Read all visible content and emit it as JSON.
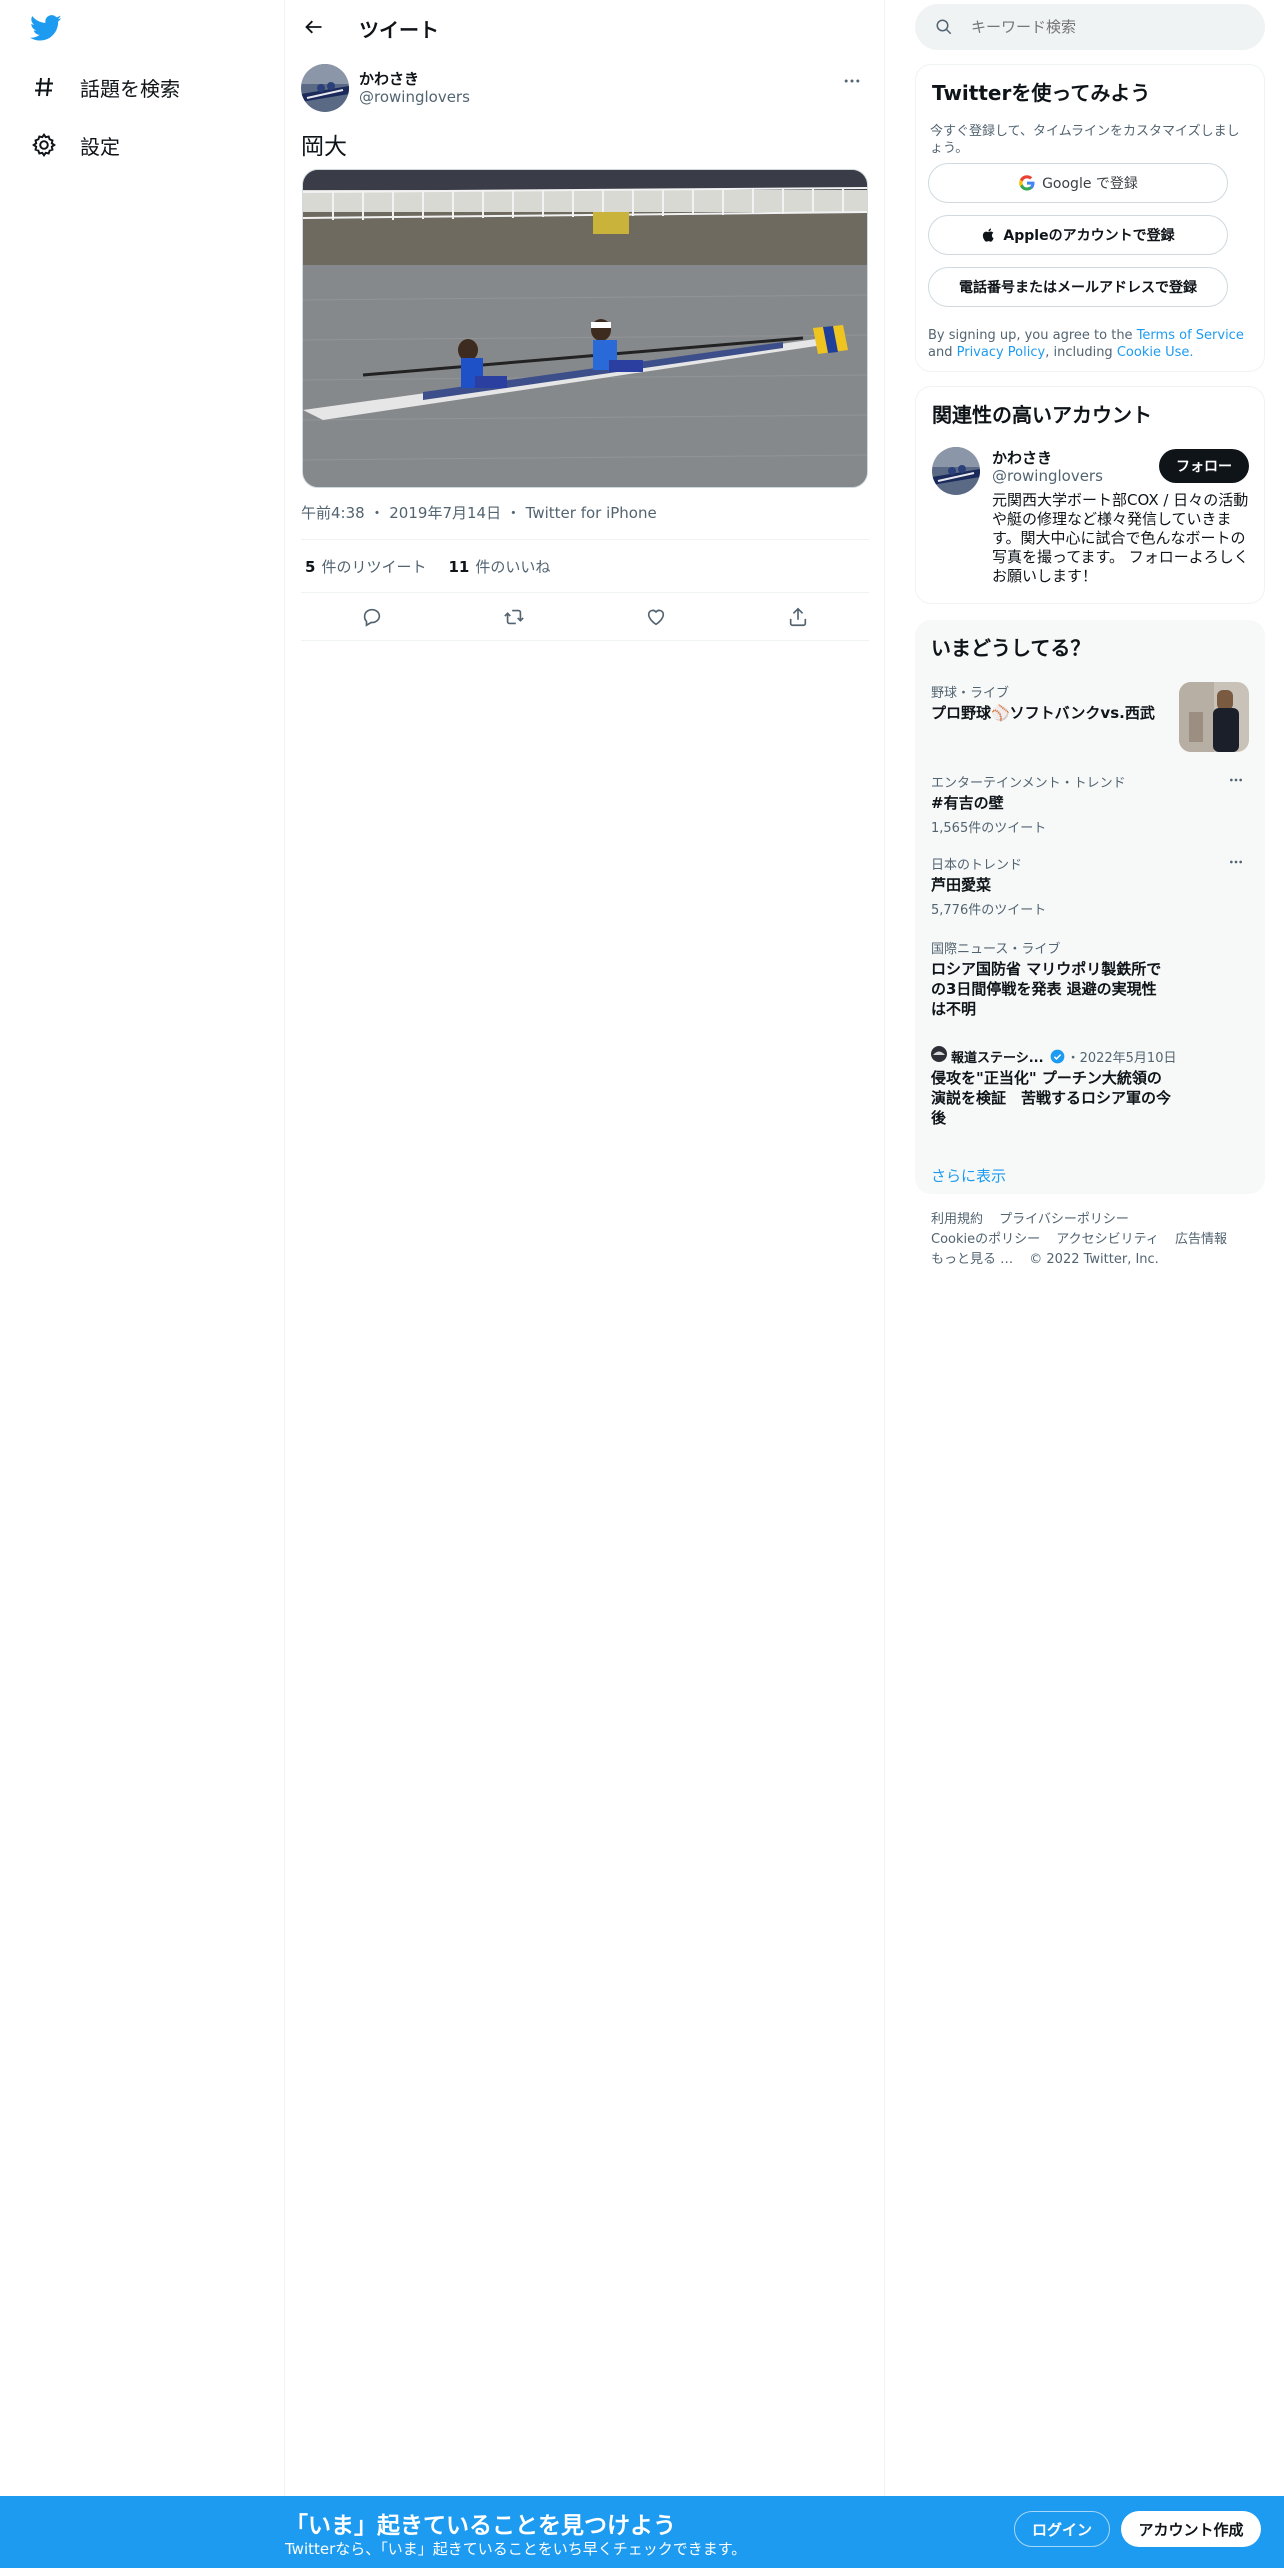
{
  "nav": {
    "explore_label": "話題を検索",
    "settings_label": "設定"
  },
  "header": {
    "title": "ツイート"
  },
  "tweet": {
    "author_name": "かわさき",
    "author_handle": "@rowinglovers",
    "text": "岡大",
    "time": "午前4:38",
    "date": "2019年7月14日",
    "source": "Twitter for iPhone",
    "retweet_count": "5",
    "retweet_label": "件のリツイート",
    "like_count": "11",
    "like_label": "件のいいね"
  },
  "search": {
    "placeholder": "キーワード検索"
  },
  "signup_card": {
    "title": "Twitterを使ってみよう",
    "desc": "今すぐ登録して、タイムラインをカスタマイズしましょう。",
    "google_label": "Google で登録",
    "apple_label": "Appleのアカウントで登録",
    "phone_label": "電話番号またはメールアドレスで登録",
    "terms_prefix": "By signing up, you agree to the",
    "terms_link": "Terms of Service",
    "terms_and": "and",
    "privacy_link": "Privacy Policy",
    "terms_including": ", including",
    "cookie_link": "Cookie Use."
  },
  "related": {
    "title": "関連性の高いアカウント",
    "name": "かわさき",
    "handle": "@rowinglovers",
    "follow_label": "フォロー",
    "bio": "元関西大学ボート部COX / 日々の活動や艇の修理など様々発信していきます。関大中心に試合で色んなボートの写真を撮ってます。 フォローよろしくお願いします！"
  },
  "trends": {
    "title": "いまどうしてる？",
    "items": [
      {
        "category": "野球・ライブ",
        "name": "プロ野球⚾ソフトバンクvs.西武"
      },
      {
        "category": "エンターテインメント・トレンド",
        "name": "#有吉の壁",
        "count": "1,565件のツイート"
      },
      {
        "category": "日本のトレンド",
        "name": "芦田愛菜",
        "count": "5,776件のツイート"
      },
      {
        "category": "国際ニュース・ライブ",
        "name": "ロシア国防省 マリウポリ製鉄所での3日間停戦を発表 退避の実現性は不明"
      },
      {
        "source": "報道ステーシ...",
        "date": "・2022年5月10日",
        "name": "侵攻を\"正当化\" プーチン大統領の演説を検証　苦戦するロシア軍の今後"
      }
    ],
    "show_more": "さらに表示"
  },
  "footer": {
    "terms": "利用規約",
    "privacy": "プライバシーポリシー",
    "cookie": "Cookieのポリシー",
    "accessibility": "アクセシビリティ",
    "ads": "広告情報",
    "more": "もっと見る …",
    "copyright": "© 2022 Twitter, Inc."
  },
  "banner": {
    "title": "「いま」起きていることを見つけよう",
    "subtitle": "Twitterなら、「いま」起きていることをいち早くチェックできます。",
    "login_label": "ログイン",
    "signup_label": "アカウント作成"
  },
  "colors": {
    "brand": "#1d9bf0",
    "text": "#0f1419",
    "muted": "#536471"
  }
}
